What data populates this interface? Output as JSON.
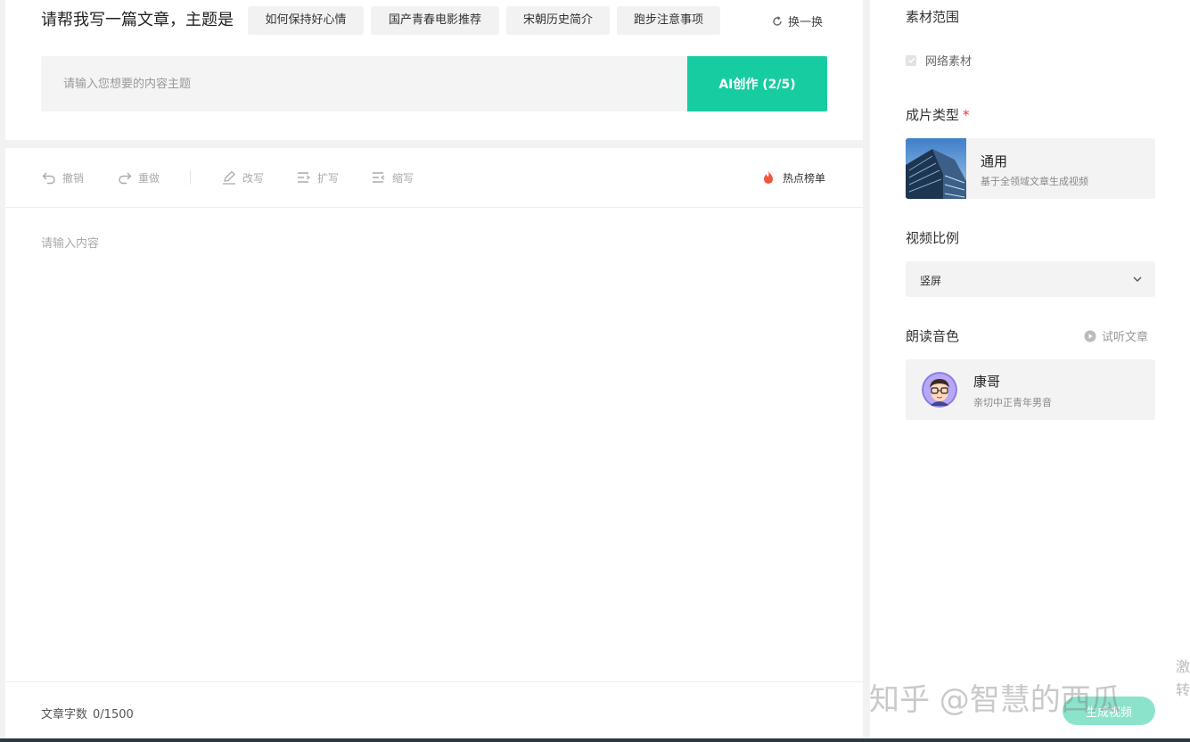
{
  "prompt": {
    "label": "请帮我写一篇文章，主题是",
    "chips": [
      "如何保持好心情",
      "国产青春电影推荐",
      "宋朝历史简介",
      "跑步注意事项"
    ],
    "refresh_label": "换一换",
    "input_placeholder": "请输入您想要的内容主题",
    "ai_button_label": "AI创作 (2/5)"
  },
  "toolbar": {
    "undo_label": "撤销",
    "redo_label": "重做",
    "rewrite_label": "改写",
    "expand_label": "扩写",
    "shorten_label": "缩写",
    "hot_label": "热点榜单"
  },
  "editor": {
    "placeholder": "请输入内容",
    "word_count_label": "文章字数",
    "word_count_value": "0/1500"
  },
  "side": {
    "material_title": "素材范围",
    "material_option": "网络素材",
    "type_title": "成片类型",
    "type_required_mark": "*",
    "type_name": "通用",
    "type_desc": "基于全领域文章生成视频",
    "ratio_title": "视频比例",
    "ratio_value": "竖屏",
    "voice_title": "朗读音色",
    "listen_label": "试听文章",
    "voice_name": "康哥",
    "voice_desc": "亲切中正青年男音",
    "generate_label": "生成视频",
    "clipped_text": "激转"
  },
  "watermark": "知乎 @智慧的西瓜",
  "colors": {
    "accent": "#17cca1",
    "accent_disabled": "#8be3cc",
    "hot_icon": "#f0563e",
    "required": "#e4393c"
  },
  "icons": {
    "refresh": "refresh-icon",
    "undo": "undo-icon",
    "redo": "redo-icon",
    "rewrite": "pen-icon",
    "expand": "expand-icon",
    "shorten": "shorten-icon",
    "hot": "flame-icon",
    "checkbox": "check-icon",
    "dropdown": "chevron-down-icon",
    "listen": "play-circle-icon"
  }
}
